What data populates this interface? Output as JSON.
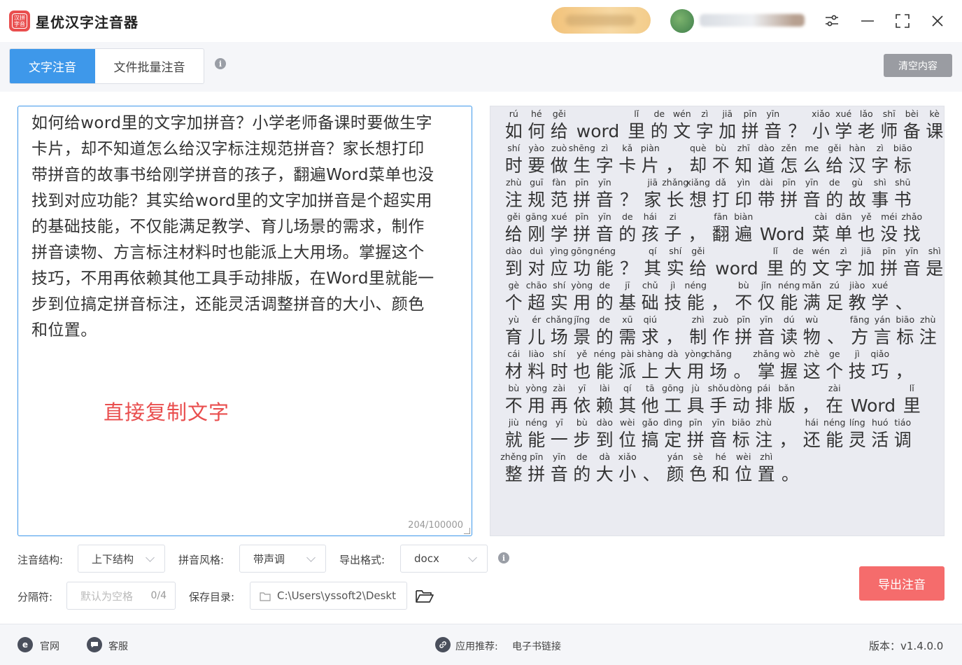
{
  "app": {
    "title": "星优汉字注音器",
    "logo_text": "汉拼字音"
  },
  "tabs": [
    {
      "label": "文字注音",
      "active": true
    },
    {
      "label": "文件批量注音",
      "active": false
    }
  ],
  "toolbar": {
    "clear_label": "清空内容"
  },
  "input": {
    "lines": [
      "如何给word里的文字加拼音？小学老师备课时要做生字",
      "卡片，却不知道怎么给汉字标注规范拼音？家长想打印",
      "带拼音的故事书给刚学拼音的孩子，翻遍Word菜单也没",
      "找到对应功能？其实给word里的文字加拼音是个超实用",
      "的基础技能，不仅能满足教学、育儿场景的需求，制作",
      "拼音读物、方言标注材料时也能派上大用场。掌握这个",
      "技巧，不用再依赖其他工具手动排版，在Word里就能一",
      "步到位搞定拼音标注，还能灵活调整拼音的大小、颜色",
      "和位置。"
    ],
    "counter": "204/100000",
    "note": "直接复制文字"
  },
  "output": {
    "rows": [
      [
        [
          "rú",
          "如"
        ],
        [
          "hé",
          "何"
        ],
        [
          "gěi",
          "给"
        ],
        [
          "",
          "word"
        ],
        [
          "lǐ",
          "里"
        ],
        [
          "de",
          "的"
        ],
        [
          "wén",
          "文"
        ],
        [
          "zì",
          "字"
        ],
        [
          "jiā",
          "加"
        ],
        [
          "pīn",
          "拼"
        ],
        [
          "yīn",
          "音"
        ],
        [
          "",
          "？"
        ],
        [
          "xiǎo",
          "小"
        ],
        [
          "xué",
          "学"
        ],
        [
          "lǎo",
          "老"
        ],
        [
          "shī",
          "师"
        ],
        [
          "bèi",
          "备"
        ],
        [
          "kè",
          "课"
        ]
      ],
      [
        [
          "shí",
          "时"
        ],
        [
          "yào",
          "要"
        ],
        [
          "zuò",
          "做"
        ],
        [
          "shēng",
          "生"
        ],
        [
          "zì",
          "字"
        ],
        [
          "kǎ",
          "卡"
        ],
        [
          "piàn",
          "片"
        ],
        [
          "",
          "，"
        ],
        [
          "què",
          "却"
        ],
        [
          "bù",
          "不"
        ],
        [
          "zhī",
          "知"
        ],
        [
          "dào",
          "道"
        ],
        [
          "zěn",
          "怎"
        ],
        [
          "me",
          "么"
        ],
        [
          "gěi",
          "给"
        ],
        [
          "hàn",
          "汉"
        ],
        [
          "zì",
          "字"
        ],
        [
          "biāo",
          "标"
        ]
      ],
      [
        [
          "zhù",
          "注"
        ],
        [
          "guī",
          "规"
        ],
        [
          "fàn",
          "范"
        ],
        [
          "pīn",
          "拼"
        ],
        [
          "yīn",
          "音"
        ],
        [
          "",
          "？"
        ],
        [
          "jiā",
          "家"
        ],
        [
          "zhǎng",
          "长"
        ],
        [
          "xiǎng",
          "想"
        ],
        [
          "dǎ",
          "打"
        ],
        [
          "yìn",
          "印"
        ],
        [
          "dài",
          "带"
        ],
        [
          "pīn",
          "拼"
        ],
        [
          "yīn",
          "音"
        ],
        [
          "de",
          "的"
        ],
        [
          "gù",
          "故"
        ],
        [
          "shì",
          "事"
        ],
        [
          "shū",
          "书"
        ]
      ],
      [
        [
          "gěi",
          "给"
        ],
        [
          "gāng",
          "刚"
        ],
        [
          "xué",
          "学"
        ],
        [
          "pīn",
          "拼"
        ],
        [
          "yīn",
          "音"
        ],
        [
          "de",
          "的"
        ],
        [
          "hái",
          "孩"
        ],
        [
          "zi",
          "子"
        ],
        [
          "",
          "，"
        ],
        [
          "fān",
          "翻"
        ],
        [
          "biàn",
          "遍"
        ],
        [
          "",
          "Word"
        ],
        [
          "cài",
          "菜"
        ],
        [
          "dān",
          "单"
        ],
        [
          "yě",
          "也"
        ],
        [
          "méi",
          "没"
        ],
        [
          "zhǎo",
          "找"
        ]
      ],
      [
        [
          "dào",
          "到"
        ],
        [
          "duì",
          "对"
        ],
        [
          "yìng",
          "应"
        ],
        [
          "gōng",
          "功"
        ],
        [
          "néng",
          "能"
        ],
        [
          "",
          "？"
        ],
        [
          "qí",
          "其"
        ],
        [
          "shí",
          "实"
        ],
        [
          "gěi",
          "给"
        ],
        [
          "",
          "word"
        ],
        [
          "lǐ",
          "里"
        ],
        [
          "de",
          "的"
        ],
        [
          "wén",
          "文"
        ],
        [
          "zì",
          "字"
        ],
        [
          "jiā",
          "加"
        ],
        [
          "pīn",
          "拼"
        ],
        [
          "yīn",
          "音"
        ],
        [
          "shì",
          "是"
        ]
      ],
      [
        [
          "gè",
          "个"
        ],
        [
          "chāo",
          "超"
        ],
        [
          "shí",
          "实"
        ],
        [
          "yòng",
          "用"
        ],
        [
          "de",
          "的"
        ],
        [
          "jī",
          "基"
        ],
        [
          "chǔ",
          "础"
        ],
        [
          "jì",
          "技"
        ],
        [
          "néng",
          "能"
        ],
        [
          "",
          "，"
        ],
        [
          "bù",
          "不"
        ],
        [
          "jǐn",
          "仅"
        ],
        [
          "néng",
          "能"
        ],
        [
          "mǎn",
          "满"
        ],
        [
          "zú",
          "足"
        ],
        [
          "jiào",
          "教"
        ],
        [
          "xué",
          "学"
        ],
        [
          "",
          "、"
        ]
      ],
      [
        [
          "yù",
          "育"
        ],
        [
          "ér",
          "儿"
        ],
        [
          "chǎng",
          "场"
        ],
        [
          "jǐng",
          "景"
        ],
        [
          "de",
          "的"
        ],
        [
          "xū",
          "需"
        ],
        [
          "qiú",
          "求"
        ],
        [
          "",
          "，"
        ],
        [
          "zhì",
          "制"
        ],
        [
          "zuò",
          "作"
        ],
        [
          "pīn",
          "拼"
        ],
        [
          "yīn",
          "音"
        ],
        [
          "dú",
          "读"
        ],
        [
          "wù",
          "物"
        ],
        [
          "",
          "、"
        ],
        [
          "fāng",
          "方"
        ],
        [
          "yán",
          "言"
        ],
        [
          "biāo",
          "标"
        ],
        [
          "zhù",
          "注"
        ]
      ],
      [
        [
          "cái",
          "材"
        ],
        [
          "liào",
          "料"
        ],
        [
          "shí",
          "时"
        ],
        [
          "yě",
          "也"
        ],
        [
          "néng",
          "能"
        ],
        [
          "pài",
          "派"
        ],
        [
          "shàng",
          "上"
        ],
        [
          "dà",
          "大"
        ],
        [
          "yòng",
          "用"
        ],
        [
          "chǎng",
          "场"
        ],
        [
          "",
          "。"
        ],
        [
          "zhǎng",
          "掌"
        ],
        [
          "wò",
          "握"
        ],
        [
          "zhè",
          "这"
        ],
        [
          "ge",
          "个"
        ],
        [
          "jì",
          "技"
        ],
        [
          "qiǎo",
          "巧"
        ],
        [
          "",
          "，"
        ]
      ],
      [
        [
          "bù",
          "不"
        ],
        [
          "yòng",
          "用"
        ],
        [
          "zài",
          "再"
        ],
        [
          "yī",
          "依"
        ],
        [
          "lài",
          "赖"
        ],
        [
          "qí",
          "其"
        ],
        [
          "tā",
          "他"
        ],
        [
          "gōng",
          "工"
        ],
        [
          "jù",
          "具"
        ],
        [
          "shǒu",
          "手"
        ],
        [
          "dòng",
          "动"
        ],
        [
          "pái",
          "排"
        ],
        [
          "bǎn",
          "版"
        ],
        [
          "",
          "，"
        ],
        [
          "zài",
          "在"
        ],
        [
          "",
          "Word"
        ],
        [
          "lǐ",
          "里"
        ]
      ],
      [
        [
          "jiù",
          "就"
        ],
        [
          "néng",
          "能"
        ],
        [
          "yī",
          "一"
        ],
        [
          "bù",
          "步"
        ],
        [
          "dào",
          "到"
        ],
        [
          "wèi",
          "位"
        ],
        [
          "gǎo",
          "搞"
        ],
        [
          "dìng",
          "定"
        ],
        [
          "pīn",
          "拼"
        ],
        [
          "yīn",
          "音"
        ],
        [
          "biāo",
          "标"
        ],
        [
          "zhù",
          "注"
        ],
        [
          "",
          "，"
        ],
        [
          "hái",
          "还"
        ],
        [
          "néng",
          "能"
        ],
        [
          "líng",
          "灵"
        ],
        [
          "huó",
          "活"
        ],
        [
          "tiáo",
          "调"
        ]
      ],
      [
        [
          "zhěng",
          "整"
        ],
        [
          "pīn",
          "拼"
        ],
        [
          "yīn",
          "音"
        ],
        [
          "de",
          "的"
        ],
        [
          "dà",
          "大"
        ],
        [
          "xiǎo",
          "小"
        ],
        [
          "",
          "、"
        ],
        [
          "yán",
          "颜"
        ],
        [
          "sè",
          "色"
        ],
        [
          "hé",
          "和"
        ],
        [
          "wèi",
          "位"
        ],
        [
          "zhì",
          "置"
        ],
        [
          "",
          "。"
        ]
      ]
    ]
  },
  "options": {
    "structure_label": "注音结构:",
    "structure_value": "上下结构",
    "style_label": "拼音风格:",
    "style_value": "带声调",
    "format_label": "导出格式:",
    "format_value": "docx",
    "separator_label": "分隔符:",
    "separator_placeholder": "默认为空格",
    "separator_count": "0/4",
    "savedir_label": "保存目录:",
    "savedir_value": "C:\\Users\\yssoft2\\Deskt",
    "export_label": "导出注音"
  },
  "footer": {
    "website_label": "官网",
    "support_label": "客服",
    "recommend_label": "应用推荐:",
    "recommend_link": "电子书链接",
    "version": "版本：v1.4.0.0"
  },
  "colors": {
    "accent": "#3e98ea",
    "danger": "#f56c6c",
    "note_red": "#e94e4e"
  }
}
